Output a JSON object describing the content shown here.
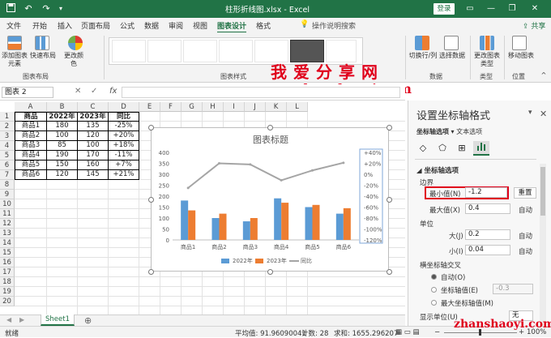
{
  "titlebar": {
    "title": "柱形折线图.xlsx - Excel",
    "login": "登录",
    "icons": [
      "save-icon",
      "undo-icon",
      "redo-icon",
      "customize-icon",
      "ribbon-options-icon",
      "minimize-icon",
      "restore-icon",
      "close-icon"
    ]
  },
  "tabs": [
    {
      "label": "文件"
    },
    {
      "label": "开始"
    },
    {
      "label": "插入"
    },
    {
      "label": "页面布局"
    },
    {
      "label": "公式"
    },
    {
      "label": "数据"
    },
    {
      "label": "审阅"
    },
    {
      "label": "视图"
    },
    {
      "label": "图表设计"
    },
    {
      "label": "格式"
    }
  ],
  "tab_search": "操作说明搜索",
  "share": "共享",
  "ribbon": {
    "add_element": "添加图表元素",
    "quick_layout": "快速布局",
    "change_colors": "更改颜色",
    "group_layout": "图表布局",
    "group_styles": "图表样式",
    "switch_rowcol": "切换行/列",
    "select_data": "选择数据",
    "group_data": "数据",
    "change_type": "更改图表类型",
    "group_type": "类型",
    "move_chart": "移动图表",
    "group_location": "位置"
  },
  "watermark": {
    "text": "我爱分享网",
    "url": "www.zhanshaoyi.com",
    "url2": "zhanshaoyi.com"
  },
  "formula": {
    "namebox": "图表 2",
    "fx": "fx"
  },
  "columns": [
    "A",
    "B",
    "C",
    "D",
    "E",
    "F",
    "G",
    "H",
    "I",
    "J",
    "K",
    "L"
  ],
  "rows": [
    "1",
    "2",
    "3",
    "4",
    "5",
    "6",
    "7",
    "8",
    "9",
    "10",
    "11",
    "12",
    "13",
    "14",
    "15",
    "16",
    "17",
    "18",
    "19",
    "20"
  ],
  "table": {
    "headers": [
      "商品",
      "2022年",
      "2023年",
      "同比"
    ],
    "rows": [
      [
        "商品1",
        "180",
        "135",
        "-25%"
      ],
      [
        "商品2",
        "100",
        "120",
        "+20%"
      ],
      [
        "商品3",
        "85",
        "100",
        "+18%"
      ],
      [
        "商品4",
        "190",
        "170",
        "-11%"
      ],
      [
        "商品5",
        "150",
        "160",
        "+7%"
      ],
      [
        "商品6",
        "120",
        "145",
        "+21%"
      ]
    ]
  },
  "chart_data": {
    "type": "bar",
    "title": "图表标题",
    "categories": [
      "商品1",
      "商品2",
      "商品3",
      "商品4",
      "商品5",
      "商品6"
    ],
    "series": [
      {
        "name": "2022年",
        "type": "bar",
        "color": "#5B9BD5",
        "axis": "left",
        "values": [
          180,
          100,
          85,
          190,
          150,
          120
        ]
      },
      {
        "name": "2023年",
        "type": "bar",
        "color": "#ED7D31",
        "axis": "left",
        "values": [
          135,
          120,
          100,
          170,
          160,
          145
        ]
      },
      {
        "name": "同比",
        "type": "line",
        "color": "#A5A5A5",
        "axis": "right",
        "values": [
          -0.25,
          0.2,
          0.18,
          -0.11,
          0.07,
          0.21
        ]
      }
    ],
    "y_left": {
      "min": 0,
      "max": 400,
      "step": 50,
      "ticks": [
        "0",
        "50",
        "100",
        "150",
        "200",
        "250",
        "300",
        "350",
        "400"
      ]
    },
    "y_right": {
      "min": -1.2,
      "max": 0.4,
      "step": 0.2,
      "ticks": [
        "+40%",
        "+20%",
        "0%",
        "-20%",
        "-40%",
        "-60%",
        "-80%",
        "-100%",
        "-120%"
      ]
    },
    "legend": "bottom",
    "grid": false
  },
  "sheet": {
    "name": "Sheet1"
  },
  "status": {
    "mode": "就绪",
    "average": "平均值: 91.96090041",
    "count": "计数: 28",
    "sum": "求和: 1655.296207",
    "zoom": "100%"
  },
  "panel": {
    "title": "设置坐标轴格式",
    "tab_axis": "坐标轴选项",
    "tab_text": "文本选项",
    "section": "坐标轴选项",
    "bounds": "边界",
    "min_label": "最小值(N)",
    "min_value": "-1.2",
    "reset": "重置",
    "max_label": "最大值(X)",
    "max_value": "0.4",
    "auto": "自动",
    "units": "单位",
    "major_label": "大(J)",
    "major_value": "0.2",
    "minor_label": "小(I)",
    "minor_value": "0.04",
    "cross": "横坐标轴交叉",
    "cross_auto": "自动(O)",
    "cross_value_label": "坐标轴值(E)",
    "cross_value": "-0.3",
    "cross_max": "最大坐标轴值(M)",
    "display_units": "显示单位(U)",
    "display_units_value": "无"
  }
}
